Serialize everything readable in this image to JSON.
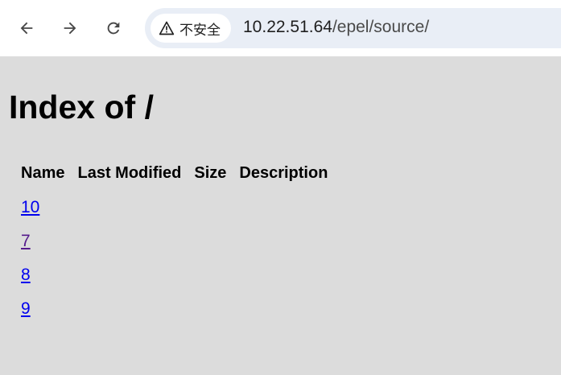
{
  "browser": {
    "security_label": "不安全",
    "url_host": "10.22.51.64",
    "url_path": "/epel/source/"
  },
  "page": {
    "title": "Index of /",
    "columns": [
      "Name",
      "Last Modified",
      "Size",
      "Description"
    ],
    "rows": [
      {
        "name": "10",
        "visited": false
      },
      {
        "name": "7",
        "visited": true
      },
      {
        "name": "8",
        "visited": false
      },
      {
        "name": "9",
        "visited": false
      }
    ]
  },
  "colors": {
    "page_background": "#dcdcdc",
    "link": "#0000ee",
    "visited_link": "#551a8b",
    "omnibox": "#e9eef6"
  },
  "icons": [
    "back-arrow-icon",
    "forward-arrow-icon",
    "reload-icon",
    "warning-triangle-icon"
  ]
}
